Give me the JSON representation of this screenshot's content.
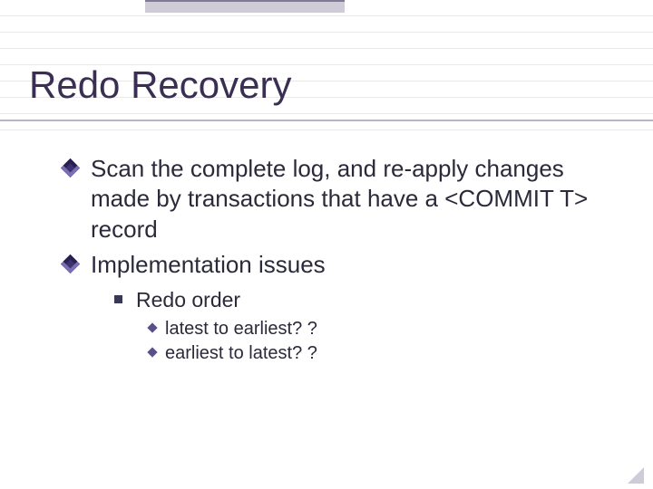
{
  "title": "Redo Recovery",
  "bullets": {
    "item0": "Scan the complete log, and re-apply changes made by transactions that have a <COMMIT T> record",
    "item1": "Implementation issues",
    "sub0": "Redo order",
    "subsub0": "latest to earliest? ?",
    "subsub1": "earliest to latest? ?"
  }
}
